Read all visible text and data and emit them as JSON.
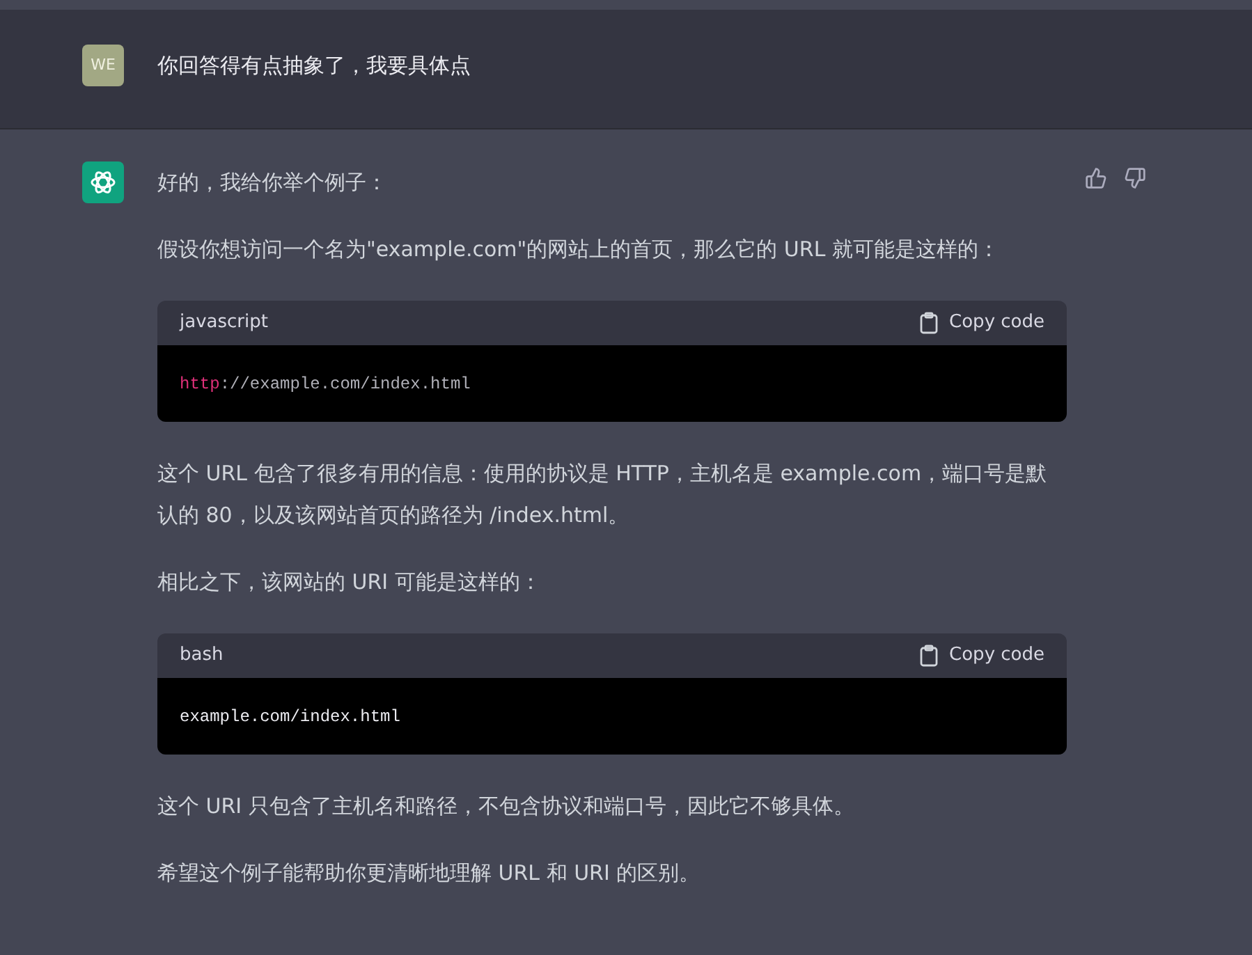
{
  "user_message": {
    "avatar": "WE",
    "text": "你回答得有点抽象了，我要具体点"
  },
  "assistant_message": {
    "blocks": [
      {
        "kind": "paragraph",
        "text": "好的，我给你举个例子："
      },
      {
        "kind": "paragraph",
        "text": "假设你想访问一个名为\"example.com\"的网站上的首页，那么它的 URL 就可能是这样的："
      },
      {
        "kind": "code",
        "language": "javascript",
        "copy_label": "Copy code",
        "segments": [
          {
            "kind": "keyword",
            "text": "http"
          },
          {
            "kind": "plain",
            "text": "://example.com/index.html"
          }
        ]
      },
      {
        "kind": "paragraph",
        "text": "这个 URL 包含了很多有用的信息：使用的协议是 HTTP，主机名是 example.com，端口号是默认的 80，以及该网站首页的路径为 /index.html。"
      },
      {
        "kind": "paragraph",
        "text": "相比之下，该网站的 URI 可能是这样的："
      },
      {
        "kind": "code",
        "language": "bash",
        "copy_label": "Copy code",
        "segments": [
          {
            "kind": "bright",
            "text": "example.com/index.html"
          }
        ]
      },
      {
        "kind": "paragraph",
        "text": "这个 URI 只包含了主机名和路径，不包含协议和端口号，因此它不够具体。"
      },
      {
        "kind": "paragraph",
        "text": "希望这个例子能帮助你更清晰地理解 URL 和 URI 的区别。"
      }
    ]
  }
}
